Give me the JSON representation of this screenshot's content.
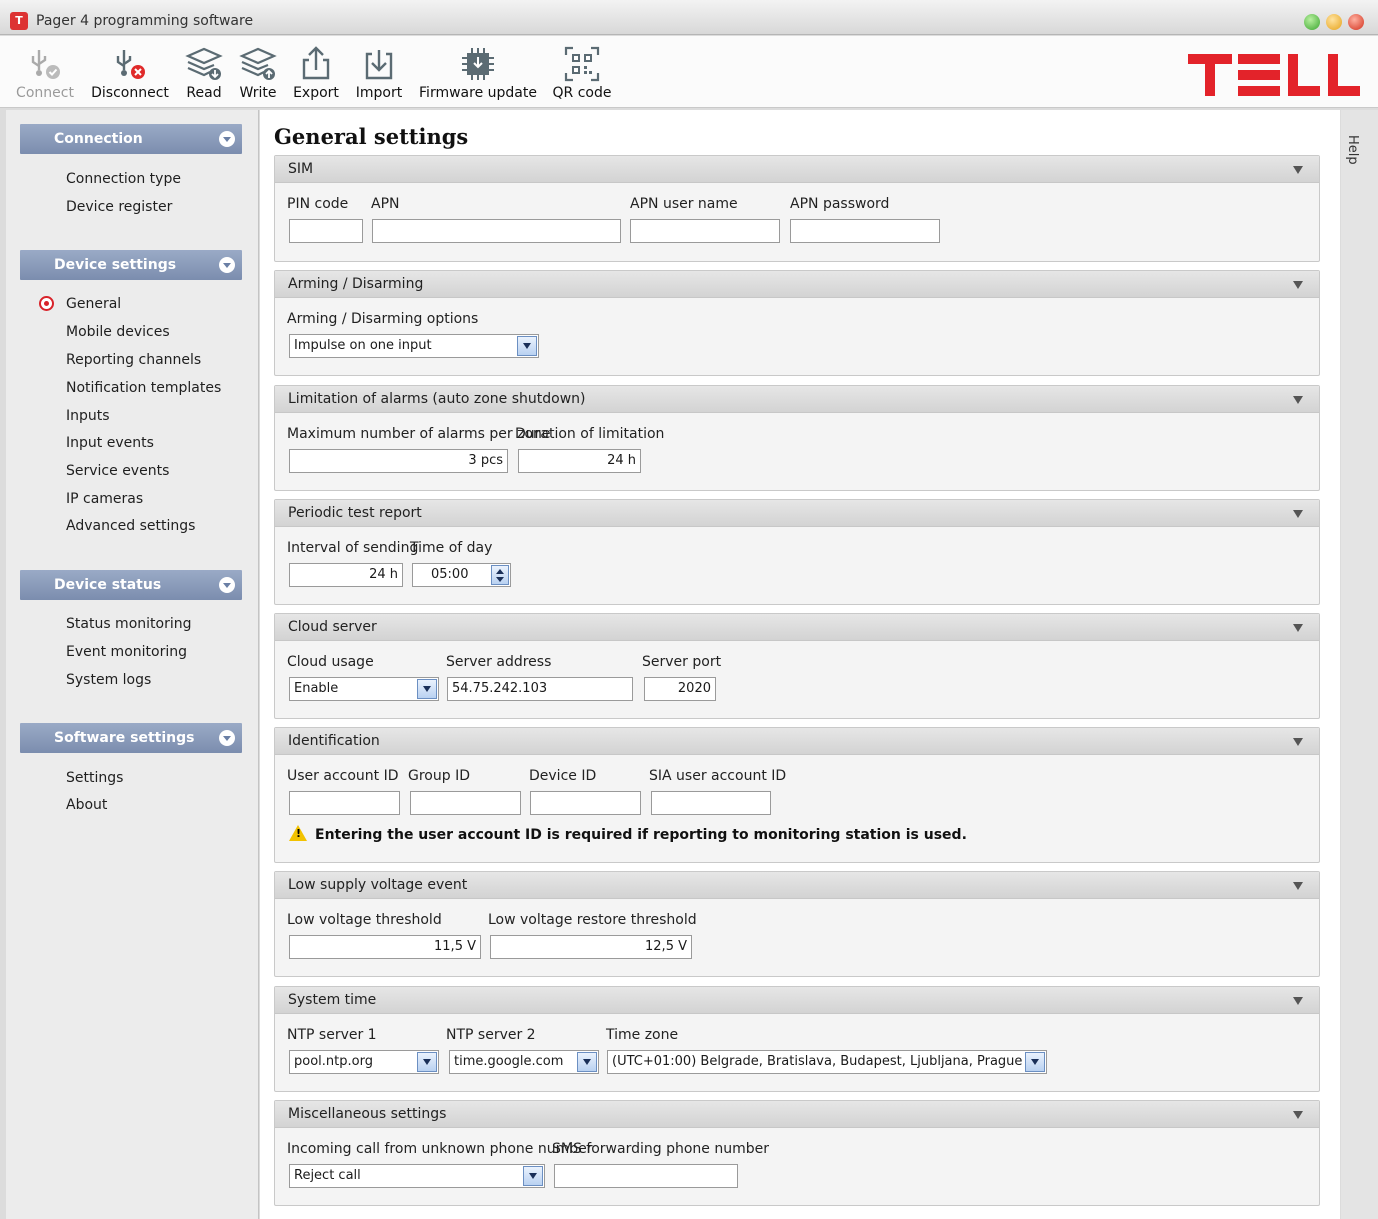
{
  "window": {
    "title": "Pager 4 programming software",
    "app_icon": "app-icon"
  },
  "toolbar": {
    "connect": "Connect",
    "disconnect": "Disconnect",
    "read": "Read",
    "write": "Write",
    "export": "Export",
    "import": "Import",
    "firmware_update": "Firmware update",
    "qr_code": "QR code"
  },
  "brand": {
    "logo_text": "TELL",
    "color": "#e3232a"
  },
  "sidebar": {
    "connection": {
      "title": "Connection",
      "items": [
        "Connection type",
        "Device register"
      ]
    },
    "device_settings": {
      "title": "Device settings",
      "items": [
        "General",
        "Mobile devices",
        "Reporting channels",
        "Notification templates",
        "Inputs",
        "Input events",
        "Service events",
        "IP cameras",
        "Advanced settings"
      ],
      "selected": "General"
    },
    "device_status": {
      "title": "Device status",
      "items": [
        "Status monitoring",
        "Event monitoring",
        "System logs"
      ]
    },
    "software_settings": {
      "title": "Software settings",
      "items": [
        "Settings",
        "About"
      ]
    }
  },
  "help_tab": "Help",
  "main": {
    "title": "General settings",
    "sim": {
      "header": "SIM",
      "pin_label": "PIN code",
      "apn_label": "APN",
      "apn_user_label": "APN user name",
      "apn_pass_label": "APN password",
      "pin": "",
      "apn": "",
      "apn_user": "",
      "apn_pass": ""
    },
    "arming": {
      "header": "Arming / Disarming",
      "options_label": "Arming / Disarming options",
      "options_value": "Impulse on one input"
    },
    "limitation": {
      "header": "Limitation of alarms (auto zone shutdown)",
      "max_label": "Maximum number of alarms per zone",
      "duration_label": "Duration of limitation",
      "max_value": "3 pcs",
      "duration_value": "24 h"
    },
    "periodic": {
      "header": "Periodic test report",
      "interval_label": "Interval of sending",
      "time_label": "Time of day",
      "interval_value": "24 h",
      "time_value": "05:00"
    },
    "cloud": {
      "header": "Cloud server",
      "usage_label": "Cloud usage",
      "address_label": "Server address",
      "port_label": "Server port",
      "usage_value": "Enable",
      "address_value": "54.75.242.103",
      "port_value": "2020"
    },
    "identification": {
      "header": "Identification",
      "user_label": "User account ID",
      "group_label": "Group ID",
      "device_label": "Device ID",
      "sia_label": "SIA user account ID",
      "warning": "Entering the user account ID is required if reporting to monitoring station is used."
    },
    "low_voltage": {
      "header": "Low supply voltage event",
      "threshold_label": "Low voltage threshold",
      "restore_label": "Low voltage restore threshold",
      "threshold_value": "11,5 V",
      "restore_value": "12,5 V"
    },
    "system_time": {
      "header": "System time",
      "ntp1_label": "NTP server 1",
      "ntp2_label": "NTP server 2",
      "tz_label": "Time zone",
      "ntp1_value": "pool.ntp.org",
      "ntp2_value": "time.google.com",
      "tz_value": "(UTC+01:00) Belgrade, Bratislava, Budapest, Ljubljana, Prague"
    },
    "misc": {
      "header": "Miscellaneous settings",
      "incoming_label": "Incoming call from unknown phone number",
      "sms_label": "SMS forwarding phone number",
      "incoming_value": "Reject call",
      "sms_value": ""
    }
  }
}
